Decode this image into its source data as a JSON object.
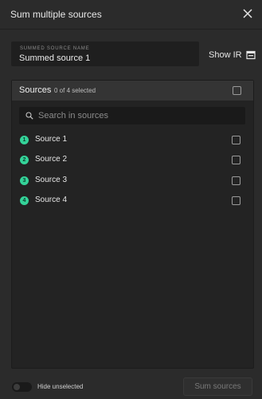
{
  "dialog": {
    "title": "Sum multiple sources",
    "close_icon": "close-icon"
  },
  "name_field": {
    "label": "SUMMED SOURCE NAME",
    "value": "Summed source 1"
  },
  "show_ir": {
    "label": "Show IR",
    "icon": "window-icon"
  },
  "sources_panel": {
    "title": "Sources",
    "selected_count": "0 of 4 selected",
    "search": {
      "placeholder": "Search in sources",
      "value": ""
    },
    "items": [
      {
        "number": "1",
        "label": "Source 1",
        "checked": false
      },
      {
        "number": "2",
        "label": "Source 2",
        "checked": false
      },
      {
        "number": "3",
        "label": "Source 3",
        "checked": false
      },
      {
        "number": "4",
        "label": "Source 4",
        "checked": false
      }
    ]
  },
  "footer": {
    "toggle_label": "Hide unselected",
    "toggle_on": false,
    "sum_button_label": "Sum sources",
    "sum_button_enabled": false
  },
  "colors": {
    "background": "#2b2b2b",
    "badge": "#34d399",
    "panel": "#232323"
  }
}
